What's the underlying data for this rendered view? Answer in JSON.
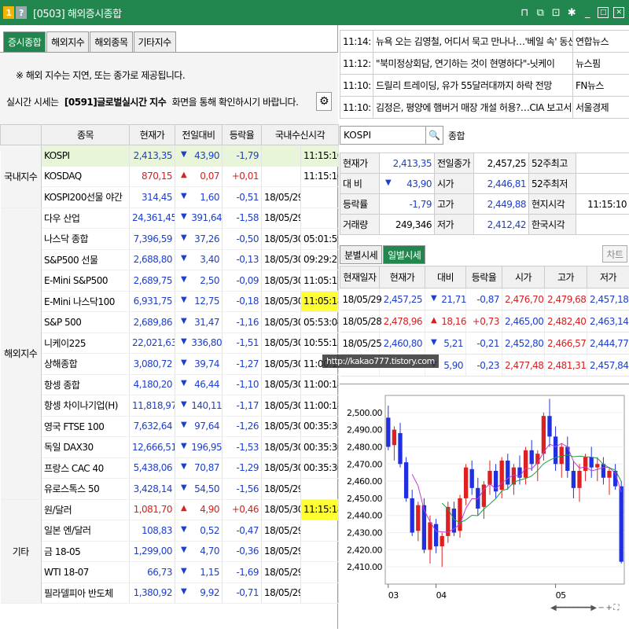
{
  "window": {
    "num": "1",
    "help": "?",
    "title": "[0503] 해외증시종합",
    "icons": [
      "layout-icon",
      "copy-icon",
      "link-icon",
      "settings-icon",
      "minimize-icon",
      "maximize-icon",
      "close-icon"
    ]
  },
  "tabs": [
    "증시종합",
    "해외지수",
    "해외종목",
    "기타지수"
  ],
  "notice": {
    "line1": "※ 해외 지수는 지연, 또는 종가로 제공됩니다.",
    "line2a": "실시간 시세는",
    "line2b": "[0591]글로벌실시간 지수",
    "line2c": "화면을 통해 확인하시기 바랍니다."
  },
  "left_table": {
    "headers": [
      "종목",
      "현재가",
      "전일대비",
      "등락율",
      "국내수신시각"
    ],
    "groups": [
      {
        "name": "국내지수",
        "rows": [
          {
            "name": "KOSPI",
            "price": "2,413,35",
            "dir": "down",
            "change": "43,90",
            "rate": "-1,79",
            "time": "11:15:10",
            "highlight": true
          },
          {
            "name": "KOSDAQ",
            "price": "870,15",
            "dir": "up",
            "change": "0,07",
            "rate": "+0,01",
            "time": "11:15:10"
          },
          {
            "name": "KOSPI200선물 야간",
            "price": "314,45",
            "dir": "down",
            "change": "1,60",
            "rate": "-0,51",
            "time": "18/05/29"
          }
        ]
      },
      {
        "name": "해외지수",
        "rows": [
          {
            "name": "다우 산업",
            "price": "24,361,45",
            "dir": "down",
            "change": "391,64",
            "rate": "-1,58",
            "time": "18/05/29"
          },
          {
            "name": "나스닥 종합",
            "price": "7,396,59",
            "dir": "down",
            "change": "37,26",
            "rate": "-0,50",
            "time": "18/05/30",
            "time2": "05:01:59"
          },
          {
            "name": "S&P500 선물",
            "price": "2,688,80",
            "dir": "down",
            "change": "3,40",
            "rate": "-0,13",
            "time": "18/05/30",
            "time2": "09:29:21"
          },
          {
            "name": "E-Mini S&P500",
            "price": "2,689,75",
            "dir": "down",
            "change": "2,50",
            "rate": "-0,09",
            "time": "18/05/30",
            "time2": "11:05:17"
          },
          {
            "name": "E-Mini 나스닥100",
            "price": "6,931,75",
            "dir": "down",
            "change": "12,75",
            "rate": "-0,18",
            "time": "18/05/30",
            "time2": "11:05:18",
            "yellow": true
          },
          {
            "name": "S&P 500",
            "price": "2,689,86",
            "dir": "down",
            "change": "31,47",
            "rate": "-1,16",
            "time": "18/05/30",
            "time2": "05:53:04"
          },
          {
            "name": "니케이225",
            "price": "22,021,63",
            "dir": "down",
            "change": "336,80",
            "rate": "-1,51",
            "time": "18/05/30",
            "time2": "10:55:15"
          },
          {
            "name": "상해종합",
            "price": "3,080,72",
            "dir": "down",
            "change": "39,74",
            "rate": "-1,27",
            "time": "18/05/30",
            "time2": "11:00:17"
          },
          {
            "name": "항셍 종합",
            "price": "4,180,20",
            "dir": "down",
            "change": "46,44",
            "rate": "-1,10",
            "time": "18/05/30",
            "time2": "11:00:18"
          },
          {
            "name": "항셍 차이나기업(H)",
            "price": "11,818,97",
            "dir": "down",
            "change": "140,11",
            "rate": "-1,17",
            "time": "18/05/30",
            "time2": "11:00:18"
          },
          {
            "name": "영국 FTSE 100",
            "price": "7,632,64",
            "dir": "down",
            "change": "97,64",
            "rate": "-1,26",
            "time": "18/05/30",
            "time2": "00:35:30"
          },
          {
            "name": "독일 DAX30",
            "price": "12,666,51",
            "dir": "down",
            "change": "196,95",
            "rate": "-1,53",
            "time": "18/05/30",
            "time2": "00:35:30"
          },
          {
            "name": "프랑스 CAC 40",
            "price": "5,438,06",
            "dir": "down",
            "change": "70,87",
            "rate": "-1,29",
            "time": "18/05/30",
            "time2": "00:35:30"
          },
          {
            "name": "유로스톡스 50",
            "price": "3,428,14",
            "dir": "down",
            "change": "54,50",
            "rate": "-1,56",
            "time": "18/05/29"
          }
        ]
      },
      {
        "name": "기타",
        "rows": [
          {
            "name": "원/달러",
            "price": "1,081,70",
            "dir": "up",
            "change": "4,90",
            "rate": "+0,46",
            "time": "18/05/30",
            "time2": "11:15:18",
            "yellow": true
          },
          {
            "name": "일본 엔/달러",
            "price": "108,83",
            "dir": "down",
            "change": "0,52",
            "rate": "-0,47",
            "time": "18/05/29"
          },
          {
            "name": "금 18-05",
            "price": "1,299,00",
            "dir": "down",
            "change": "4,70",
            "rate": "-0,36",
            "time": "18/05/29"
          },
          {
            "name": "WTI 18-07",
            "price": "66,73",
            "dir": "down",
            "change": "1,15",
            "rate": "-1,69",
            "time": "18/05/29"
          },
          {
            "name": "필라델피아 반도체",
            "price": "1,380,92",
            "dir": "down",
            "change": "9,92",
            "rate": "-0,71",
            "time": "18/05/29"
          }
        ]
      }
    ]
  },
  "news": [
    {
      "time": "11:14:",
      "title": "뉴욕 오는 김영철, 어디서 묵고 만나나…'베일 속' 동선",
      "source": "연합뉴스"
    },
    {
      "time": "11:12:",
      "title": "\"북미정상회담, 연기하는 것이 현명하다\"-닛케이",
      "source": "뉴스핌"
    },
    {
      "time": "11:10:",
      "title": "드릴리 트레이딩, 유가 55달러대까지 하락 전망",
      "source": "FN뉴스"
    },
    {
      "time": "11:10:",
      "title": "김정은, 평양에 햄버거 매장 개설 허용?…CIA 보고서",
      "source": "서울경제"
    }
  ],
  "search": {
    "value": "KOSPI",
    "name": "종합"
  },
  "quote": {
    "rows": [
      [
        "현재가",
        "2,413,35",
        "전일종가",
        "2,457,25",
        "52주최고",
        ""
      ],
      [
        "대 비",
        "43,90",
        "시가",
        "2,446,81",
        "52주최저",
        ""
      ],
      [
        "등락률",
        "-1,79",
        "고가",
        "2,449,88",
        "현지시각",
        "11:15:10"
      ],
      [
        "거래량",
        "249,346",
        "저가",
        "2,412,42",
        "한국시각",
        ""
      ]
    ]
  },
  "tabs2": [
    "분별시세",
    "일별시세"
  ],
  "chart_button": "차트",
  "daily": {
    "headers": [
      "현재일자",
      "현재가",
      "대비",
      "등락율",
      "시가",
      "고가",
      "저가"
    ],
    "rows": [
      {
        "date": "18/05/29",
        "price": "2,457,25",
        "dir": "down",
        "change": "21,71",
        "rate": "-0,87",
        "open": "2,476,70",
        "high": "2,479,68",
        "low": "2,457,18"
      },
      {
        "date": "18/05/28",
        "price": "2,478,96",
        "dir": "up",
        "change": "18,16",
        "rate": "+0,73",
        "open": "2,465,00",
        "high": "2,482,40",
        "low": "2,463,14"
      },
      {
        "date": "18/05/25",
        "price": "2,460,80",
        "dir": "down",
        "change": "5,21",
        "rate": "-0,21",
        "open": "2,452,80",
        "high": "2,466,57",
        "low": "2,444,77"
      },
      {
        "date": "",
        "price": "",
        "dir": "down",
        "change": "5,90",
        "rate": "-0,23",
        "open": "2,477,48",
        "high": "2,481,31",
        "low": "2,457,84"
      }
    ]
  },
  "watermark": "http://kakao777.tistory.com",
  "chart_data": {
    "type": "candlestick",
    "ylim": [
      2400,
      2510
    ],
    "yticks": [
      "2,500.00",
      "2,490.00",
      "2,480.00",
      "2,470.00",
      "2,460.00",
      "2,450.00",
      "2,440.00",
      "2,430.00",
      "2,420.00",
      "2,410.00"
    ],
    "ytick_values": [
      2500,
      2490,
      2480,
      2470,
      2460,
      2450,
      2440,
      2430,
      2420,
      2410
    ],
    "xticks": [
      {
        "label": "03",
        "index": 0
      },
      {
        "label": "04",
        "index": 8
      },
      {
        "label": "05",
        "index": 28
      }
    ],
    "candles": [
      [
        2497,
        2504,
        2478,
        2480
      ],
      [
        2481,
        2492,
        2472,
        2490
      ],
      [
        2488,
        2494,
        2468,
        2470
      ],
      [
        2471,
        2474,
        2448,
        2450
      ],
      [
        2450,
        2455,
        2428,
        2430
      ],
      [
        2431,
        2448,
        2425,
        2446
      ],
      [
        2446,
        2450,
        2418,
        2420
      ],
      [
        2420,
        2440,
        2412,
        2436
      ],
      [
        2435,
        2438,
        2418,
        2422
      ],
      [
        2422,
        2430,
        2410,
        2428
      ],
      [
        2428,
        2448,
        2424,
        2445
      ],
      [
        2444,
        2448,
        2428,
        2430
      ],
      [
        2431,
        2452,
        2427,
        2450
      ],
      [
        2450,
        2470,
        2446,
        2468
      ],
      [
        2467,
        2472,
        2452,
        2456
      ],
      [
        2456,
        2462,
        2440,
        2444
      ],
      [
        2445,
        2460,
        2438,
        2458
      ],
      [
        2458,
        2472,
        2452,
        2466
      ],
      [
        2466,
        2470,
        2450,
        2454
      ],
      [
        2455,
        2474,
        2450,
        2472
      ],
      [
        2472,
        2476,
        2455,
        2458
      ],
      [
        2458,
        2470,
        2452,
        2468
      ],
      [
        2468,
        2475,
        2458,
        2462
      ],
      [
        2462,
        2480,
        2458,
        2478
      ],
      [
        2478,
        2484,
        2466,
        2470
      ],
      [
        2470,
        2478,
        2460,
        2476
      ],
      [
        2476,
        2500,
        2472,
        2498
      ],
      [
        2498,
        2508,
        2480,
        2486
      ],
      [
        2486,
        2492,
        2466,
        2470
      ],
      [
        2470,
        2482,
        2462,
        2480
      ],
      [
        2480,
        2486,
        2462,
        2466
      ],
      [
        2466,
        2472,
        2450,
        2456
      ],
      [
        2456,
        2470,
        2448,
        2466
      ],
      [
        2466,
        2476,
        2460,
        2474
      ],
      [
        2474,
        2480,
        2462,
        2468
      ],
      [
        2468,
        2474,
        2460,
        2470
      ],
      [
        2470,
        2474,
        2458,
        2462
      ],
      [
        2462,
        2468,
        2452,
        2466
      ],
      [
        2466,
        2470,
        2455,
        2457
      ],
      [
        2457,
        2460,
        2412,
        2413
      ]
    ],
    "colors": {
      "up": "#e02020",
      "down": "#2030e0",
      "ma5": "#c040d0",
      "ma20": "#20a040"
    }
  }
}
